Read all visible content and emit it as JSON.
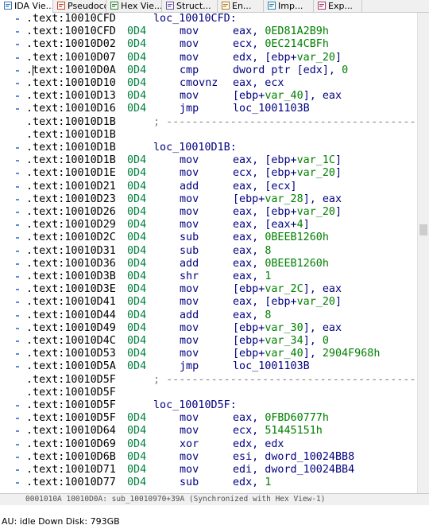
{
  "tabs": [
    {
      "label": "IDA Vie...",
      "icon": "ida-view-icon",
      "active": true,
      "closeable": true
    },
    {
      "label": "Pseudoco...",
      "icon": "pseudocode-icon",
      "active": false,
      "closeable": false
    },
    {
      "label": "Hex Vie...",
      "icon": "hex-view-icon",
      "active": false,
      "closeable": false
    },
    {
      "label": "Struct...",
      "icon": "structures-icon",
      "active": false,
      "closeable": false
    },
    {
      "label": "En...",
      "icon": "enums-icon",
      "active": false,
      "closeable": false
    },
    {
      "label": "Imp...",
      "icon": "imports-icon",
      "active": false,
      "closeable": false
    },
    {
      "label": "Exp...",
      "icon": "exports-icon",
      "active": false,
      "closeable": false
    }
  ],
  "close_glyph": "×",
  "listing": [
    {
      "type": "label",
      "addr": ".text:10010CFD",
      "label": "loc_10010CFD:"
    },
    {
      "type": "ins",
      "addr": ".text:10010CFD",
      "op": "0D4",
      "mn": "mov",
      "args": "eax, 0ED81A2B9h"
    },
    {
      "type": "ins",
      "addr": ".text:10010D02",
      "op": "0D4",
      "mn": "mov",
      "args": "ecx, 0EC214CBFh"
    },
    {
      "type": "ins",
      "addr": ".text:10010D07",
      "op": "0D4",
      "mn": "mov",
      "args": "edx, [ebp+var_20]"
    },
    {
      "type": "ins",
      "addr": ".text:10010D0A",
      "op": "0D4",
      "mn": "cmp",
      "args": "dword ptr [edx], 0",
      "current": true
    },
    {
      "type": "ins",
      "addr": ".text:10010D10",
      "op": "0D4",
      "mn": "cmovnz",
      "args": "eax, ecx"
    },
    {
      "type": "ins",
      "addr": ".text:10010D13",
      "op": "0D4",
      "mn": "mov",
      "args": "[ebp+var_40], eax"
    },
    {
      "type": "ins",
      "addr": ".text:10010D16",
      "op": "0D4",
      "mn": "jmp",
      "args": "loc_1001103B"
    },
    {
      "type": "sep",
      "addr": ".text:10010D1B",
      "text": "; -----------------------------------------"
    },
    {
      "type": "blank",
      "addr": ".text:10010D1B"
    },
    {
      "type": "label",
      "addr": ".text:10010D1B",
      "label": "loc_10010D1B:"
    },
    {
      "type": "ins",
      "addr": ".text:10010D1B",
      "op": "0D4",
      "mn": "mov",
      "args": "eax, [ebp+var_1C]"
    },
    {
      "type": "ins",
      "addr": ".text:10010D1E",
      "op": "0D4",
      "mn": "mov",
      "args": "ecx, [ebp+var_20]"
    },
    {
      "type": "ins",
      "addr": ".text:10010D21",
      "op": "0D4",
      "mn": "add",
      "args": "eax, [ecx]"
    },
    {
      "type": "ins",
      "addr": ".text:10010D23",
      "op": "0D4",
      "mn": "mov",
      "args": "[ebp+var_28], eax"
    },
    {
      "type": "ins",
      "addr": ".text:10010D26",
      "op": "0D4",
      "mn": "mov",
      "args": "eax, [ebp+var_20]"
    },
    {
      "type": "ins",
      "addr": ".text:10010D29",
      "op": "0D4",
      "mn": "mov",
      "args": "eax, [eax+4]"
    },
    {
      "type": "ins",
      "addr": ".text:10010D2C",
      "op": "0D4",
      "mn": "sub",
      "args": "eax, 0BEEB1260h"
    },
    {
      "type": "ins",
      "addr": ".text:10010D31",
      "op": "0D4",
      "mn": "sub",
      "args": "eax, 8"
    },
    {
      "type": "ins",
      "addr": ".text:10010D36",
      "op": "0D4",
      "mn": "add",
      "args": "eax, 0BEEB1260h"
    },
    {
      "type": "ins",
      "addr": ".text:10010D3B",
      "op": "0D4",
      "mn": "shr",
      "args": "eax, 1"
    },
    {
      "type": "ins",
      "addr": ".text:10010D3E",
      "op": "0D4",
      "mn": "mov",
      "args": "[ebp+var_2C], eax"
    },
    {
      "type": "ins",
      "addr": ".text:10010D41",
      "op": "0D4",
      "mn": "mov",
      "args": "eax, [ebp+var_20]"
    },
    {
      "type": "ins",
      "addr": ".text:10010D44",
      "op": "0D4",
      "mn": "add",
      "args": "eax, 8"
    },
    {
      "type": "ins",
      "addr": ".text:10010D49",
      "op": "0D4",
      "mn": "mov",
      "args": "[ebp+var_30], eax"
    },
    {
      "type": "ins",
      "addr": ".text:10010D4C",
      "op": "0D4",
      "mn": "mov",
      "args": "[ebp+var_34], 0"
    },
    {
      "type": "ins",
      "addr": ".text:10010D53",
      "op": "0D4",
      "mn": "mov",
      "args": "[ebp+var_40], 2904F968h"
    },
    {
      "type": "ins",
      "addr": ".text:10010D5A",
      "op": "0D4",
      "mn": "jmp",
      "args": "loc_1001103B"
    },
    {
      "type": "sep",
      "addr": ".text:10010D5F",
      "text": "; -----------------------------------------"
    },
    {
      "type": "blank",
      "addr": ".text:10010D5F"
    },
    {
      "type": "label",
      "addr": ".text:10010D5F",
      "label": "loc_10010D5F:"
    },
    {
      "type": "ins",
      "addr": ".text:10010D5F",
      "op": "0D4",
      "mn": "mov",
      "args": "eax, 0FBD60777h"
    },
    {
      "type": "ins",
      "addr": ".text:10010D64",
      "op": "0D4",
      "mn": "mov",
      "args": "ecx, 51445151h"
    },
    {
      "type": "ins",
      "addr": ".text:10010D69",
      "op": "0D4",
      "mn": "xor",
      "args": "edx, edx"
    },
    {
      "type": "ins",
      "addr": ".text:10010D6B",
      "op": "0D4",
      "mn": "mov",
      "args": "esi, dword_10024BB8"
    },
    {
      "type": "ins",
      "addr": ".text:10010D71",
      "op": "0D4",
      "mn": "mov",
      "args": "edi, dword_10024BB4"
    },
    {
      "type": "ins",
      "addr": ".text:10010D77",
      "op": "0D4",
      "mn": "sub",
      "args": "edx, 1"
    }
  ],
  "sync_status": "0001010A 10010D0A: sub_10010970+39A (Synchronized with Hex View-1)",
  "status_bar": "AU:  idle   Down Disk: 793GB",
  "colors": {
    "address": "#000000",
    "opcode": "#008040",
    "mnemonic": "#000080",
    "variable": "#008000",
    "separator": "#808080",
    "gutter_marker": "#5b8bd6"
  }
}
